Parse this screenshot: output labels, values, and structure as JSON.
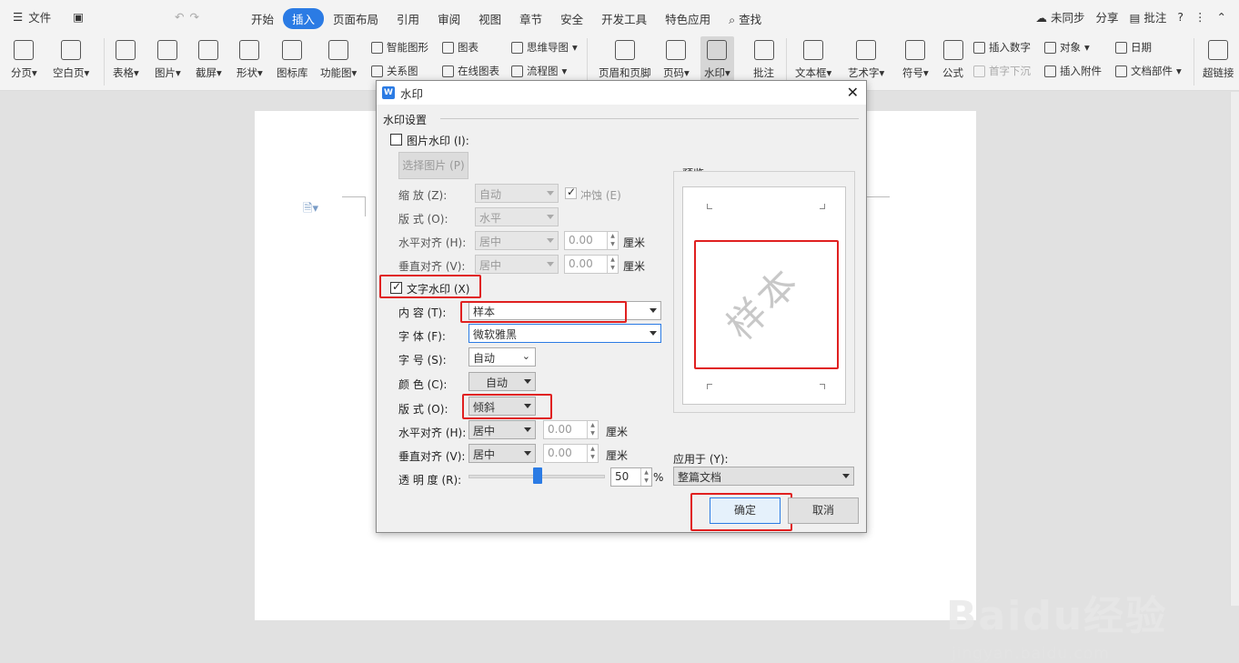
{
  "menubar": {
    "file": "文件",
    "tabs": [
      "开始",
      "插入",
      "页面布局",
      "引用",
      "审阅",
      "视图",
      "章节",
      "安全",
      "开发工具",
      "特色应用"
    ],
    "search": "查找",
    "sync": "未同步",
    "share": "分享",
    "comment": "批注",
    "help": "?"
  },
  "ribbon": {
    "items": [
      "分页",
      "空白页",
      "表格",
      "图片",
      "截屏",
      "形状",
      "图标库",
      "功能图",
      "页眉和页脚",
      "页码",
      "水印",
      "批注",
      "文本框",
      "艺术字",
      "符号",
      "公式",
      "超链接"
    ],
    "small": [
      "智能图形",
      "图表",
      "思维导图",
      "关系图",
      "在线图表",
      "流程图",
      "插入数字",
      "对象",
      "日期",
      "首字下沉",
      "插入附件",
      "文档部件"
    ]
  },
  "dialog": {
    "title": "水印",
    "group": "水印设置",
    "picture_wm": "图片水印 (I):",
    "select_picture": "选择图片 (P)",
    "scale_label": "缩    放 (Z):",
    "scale_value": "自动",
    "washout": "冲蚀 (E)",
    "layout_label": "版    式 (O):",
    "layout_value": "水平",
    "halign_label": "水平对齐 (H):",
    "halign_value": "居中",
    "halign_num": "0.00",
    "valign_label": "垂直对齐 (V):",
    "valign_value": "居中",
    "valign_num": "0.00",
    "unit": "厘米",
    "text_wm": "文字水印 (X)",
    "content_label": "内    容 (T):",
    "content_value": "样本",
    "font_label": "字    体 (F):",
    "font_value": "微软雅黑",
    "size_label": "字    号 (S):",
    "size_value": "自动",
    "color_label": "颜    色 (C):",
    "color_value": "自动",
    "t_layout_label": "版    式 (O):",
    "t_layout_value": "倾斜",
    "t_halign_label": "水平对齐 (H):",
    "t_halign_value": "居中",
    "t_halign_num": "0.00",
    "t_valign_label": "垂直对齐 (V):",
    "t_valign_value": "居中",
    "t_valign_num": "0.00",
    "transparency_label": "透 明 度 (R):",
    "transparency_value": "50",
    "transparency_percent": 0.5,
    "percent": "%",
    "preview": "预览",
    "preview_text": "样本",
    "apply_label": "应用于 (Y):",
    "apply_value": "整篇文档",
    "ok": "确定",
    "cancel": "取消"
  },
  "watermark": {
    "brand": "Baidu经验",
    "url": "jingyan.baidu.com"
  },
  "colors": {
    "accent": "#2b7be4",
    "highlight": "#e02020"
  }
}
